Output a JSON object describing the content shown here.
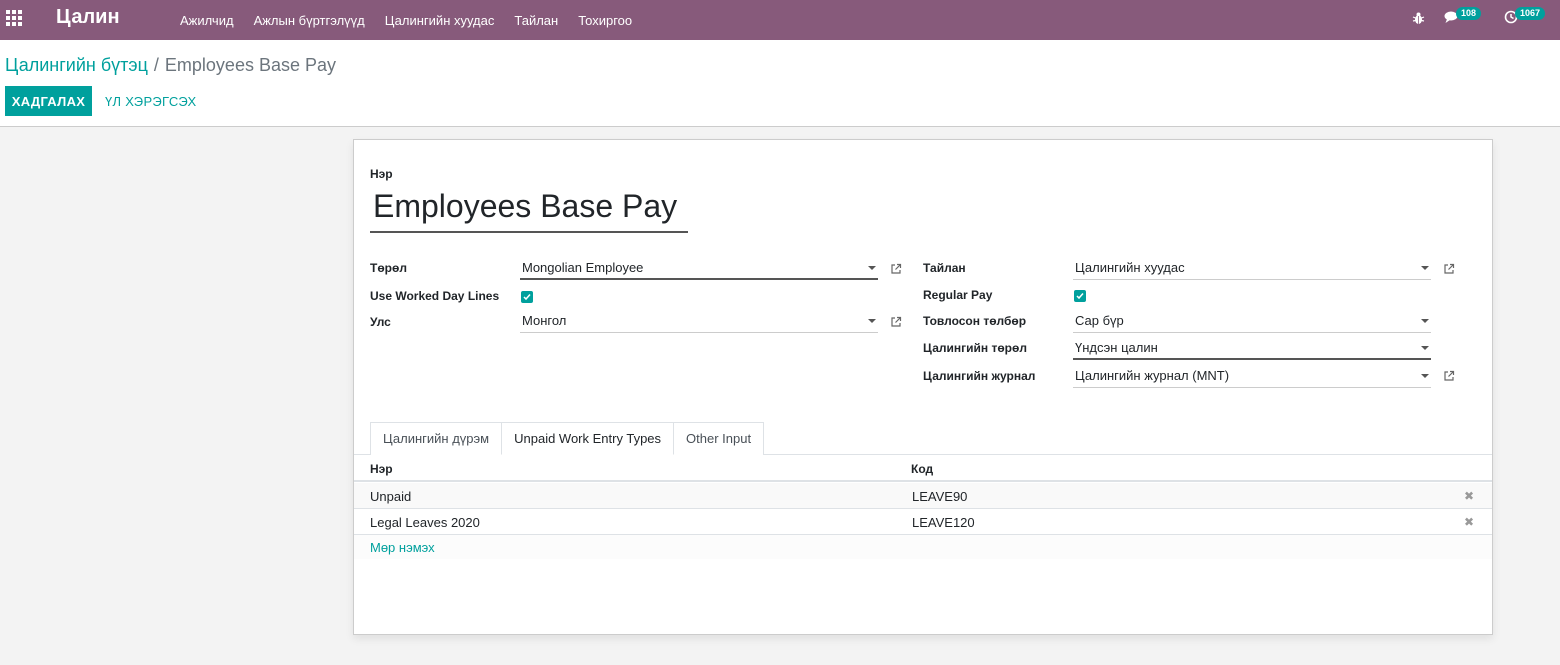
{
  "navbar": {
    "brand": "Цалин",
    "menu": [
      "Ажилчид",
      "Ажлын бүртгэлүүд",
      "Цалингийн хуудас",
      "Тайлан",
      "Тохиргоо"
    ],
    "messages_count": "108",
    "activities_count": "1067"
  },
  "breadcrumb": {
    "parent": "Цалингийн бүтэц",
    "separator": "/",
    "current": "Employees Base Pay"
  },
  "toolbar": {
    "save_label": "ХАДГАЛАХ",
    "tools_label": "ҮЛ ХЭРЭГСЭХ"
  },
  "form": {
    "name_label": "Нэр",
    "name_value": "Employees Base Pay",
    "left": {
      "type_label": "Төрөл",
      "type_value": "Mongolian Employee",
      "worked_days_label": "Use Worked Day Lines",
      "worked_days_checked": true,
      "country_label": "Улс",
      "country_value": "Монгол"
    },
    "right": {
      "report_label": "Тайлан",
      "report_value": "Цалингийн хуудас",
      "regular_pay_label": "Regular Pay",
      "regular_pay_checked": true,
      "schedule_label": "Товлосон төлбөр",
      "schedule_value": "Сар бүр",
      "salary_type_label": "Цалингийн төрөл",
      "salary_type_value": "Үндсэн цалин",
      "journal_label": "Цалингийн журнал",
      "journal_value": "Цалингийн журнал (MNT)"
    }
  },
  "tabs": [
    {
      "label": "Цалингийн дүрэм",
      "active": false
    },
    {
      "label": "Unpaid Work Entry Types",
      "active": true
    },
    {
      "label": "Other Input",
      "active": false
    }
  ],
  "table": {
    "columns": [
      "Нэр",
      "Код"
    ],
    "rows": [
      {
        "name": "Unpaid",
        "code": "LEAVE90"
      },
      {
        "name": "Legal Leaves 2020",
        "code": "LEAVE120"
      }
    ],
    "add_line": "Мөр нэмэх"
  },
  "colors": {
    "navbar": "#875a7b",
    "accent": "#00a09d"
  }
}
